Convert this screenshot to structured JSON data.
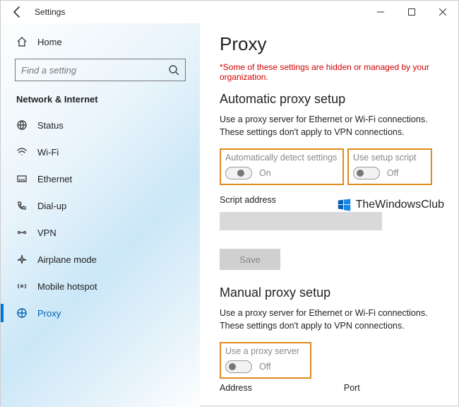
{
  "titlebar": {
    "caption": "Settings"
  },
  "sidebar": {
    "home": "Home",
    "search_placeholder": "Find a setting",
    "section": "Network & Internet",
    "items": [
      {
        "label": "Status"
      },
      {
        "label": "Wi-Fi"
      },
      {
        "label": "Ethernet"
      },
      {
        "label": "Dial-up"
      },
      {
        "label": "VPN"
      },
      {
        "label": "Airplane mode"
      },
      {
        "label": "Mobile hotspot"
      },
      {
        "label": "Proxy"
      }
    ]
  },
  "content": {
    "title": "Proxy",
    "warning": "*Some of these settings are hidden or managed by your organization.",
    "auto": {
      "heading": "Automatic proxy setup",
      "desc": "Use a proxy server for Ethernet or Wi-Fi connections. These settings don't apply to VPN connections.",
      "detect_label": "Automatically detect settings",
      "detect_state": "On",
      "script_label": "Use setup script",
      "script_state": "Off",
      "script_addr_label": "Script address",
      "save": "Save"
    },
    "manual": {
      "heading": "Manual proxy setup",
      "desc": "Use a proxy server for Ethernet or Wi-Fi connections. These settings don't apply to VPN connections.",
      "use_label": "Use a proxy server",
      "use_state": "Off",
      "addr_label": "Address",
      "port_label": "Port"
    }
  },
  "watermark": "TheWindowsClub"
}
